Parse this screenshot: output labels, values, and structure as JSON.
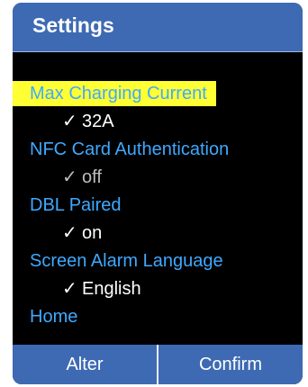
{
  "header": {
    "title": "Settings"
  },
  "menu": [
    {
      "label": "Max Charging Current",
      "value": "32A",
      "highlighted": true
    },
    {
      "label": "NFC Card Authentication",
      "value": "off",
      "dim": true
    },
    {
      "label": "DBL Paired",
      "value": "on"
    },
    {
      "label": "Screen Alarm Language",
      "value": "English"
    }
  ],
  "home_label": "Home",
  "check_glyph": "✓",
  "footer": {
    "alter_label": "Alter",
    "confirm_label": "Confirm"
  },
  "colors": {
    "header_bg": "#3e6ab3",
    "label_blue": "#3fa9ff",
    "highlight_yellow": "#ffff33",
    "screen_bg": "#000000"
  }
}
